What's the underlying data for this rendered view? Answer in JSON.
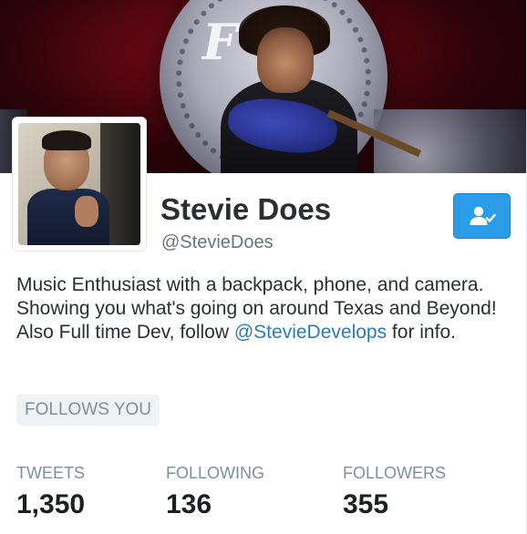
{
  "profile": {
    "name": "Stevie Does",
    "handle": "@StevieDoes",
    "bio_text": "Music Enthusiast with a backpack, phone, and camera. Showing you what's going on around Texas and Beyond! Also Full time Dev, follow ",
    "bio_mention": "@StevieDevelops",
    "bio_suffix": " for info.",
    "follows_you": "FOLLOWS YOU"
  },
  "stats": [
    {
      "label": "TWEETS",
      "value": "1,350"
    },
    {
      "label": "FOLLOWING",
      "value": "136"
    },
    {
      "label": "FOLLOWERS",
      "value": "355"
    }
  ],
  "follow_button": {
    "icon": "following-user-check-icon",
    "color": "#2b9de8"
  },
  "colors": {
    "accent": "#2b9de8",
    "link": "#2b7bb9",
    "text": "#292f33",
    "muted": "#7d8f9c"
  }
}
